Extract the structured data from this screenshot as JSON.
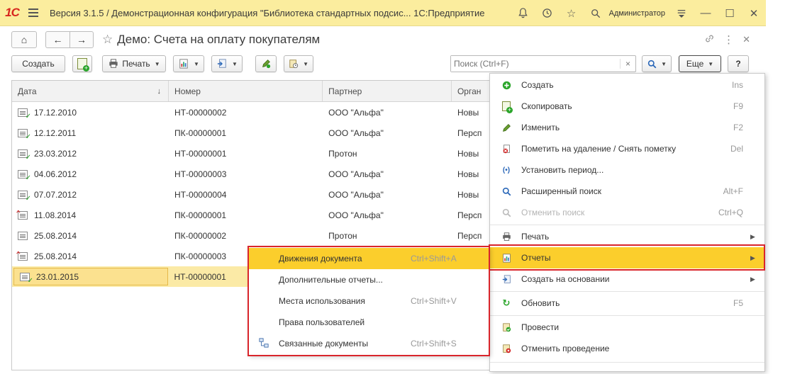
{
  "window": {
    "logo": "1С",
    "title": "Версия 3.1.5 / Демонстрационная конфигурация \"Библиотека стандартных подсис...  1С:Предприятие",
    "user": "Администратор"
  },
  "form": {
    "title": "Демо: Счета на оплату покупателям"
  },
  "toolbar": {
    "create_label": "Создать",
    "print_label": "Печать",
    "search_placeholder": "Поиск (Ctrl+F)",
    "more_label": "Еще",
    "help_label": "?"
  },
  "table": {
    "columns": [
      "Дата",
      "Номер",
      "Партнер",
      "Орган"
    ],
    "rows": [
      {
        "date": "17.12.2010",
        "number": "НТ-00000002",
        "partner": "ООО \"Альфа\"",
        "org": "Новы",
        "status": "posted"
      },
      {
        "date": "12.12.2011",
        "number": "ПК-00000001",
        "partner": "ООО \"Альфа\"",
        "org": "Персп",
        "status": "posted"
      },
      {
        "date": "23.03.2012",
        "number": "НТ-00000001",
        "partner": "Протон",
        "org": "Новы",
        "status": "posted"
      },
      {
        "date": "04.06.2012",
        "number": "НТ-00000003",
        "partner": "ООО \"Альфа\"",
        "org": "Новы",
        "status": "posted"
      },
      {
        "date": "07.07.2012",
        "number": "НТ-00000004",
        "partner": "ООО \"Альфа\"",
        "org": "Новы",
        "status": "posted"
      },
      {
        "date": "11.08.2014",
        "number": "ПК-00000001",
        "partner": "ООО \"Альфа\"",
        "org": "Персп",
        "status": "deleted"
      },
      {
        "date": "25.08.2014",
        "number": "ПК-00000002",
        "partner": "Протон",
        "org": "Персп",
        "status": "draft"
      },
      {
        "date": "25.08.2014",
        "number": "ПК-00000003",
        "partner": "",
        "org": "",
        "status": "deleted"
      },
      {
        "date": "23.01.2015",
        "number": "НТ-00000001",
        "partner": "",
        "org": "",
        "status": "posted"
      }
    ]
  },
  "menu": {
    "items": [
      {
        "label": "Создать",
        "key": "Ins",
        "icon": "plus-circle-icon"
      },
      {
        "label": "Скопировать",
        "key": "F9",
        "icon": "copy-icon"
      },
      {
        "label": "Изменить",
        "key": "F2",
        "icon": "pencil-icon"
      },
      {
        "label": "Пометить на удаление / Снять пометку",
        "key": "Del",
        "icon": "delete-mark-icon"
      },
      {
        "label": "Установить период...",
        "key": "",
        "icon": "period-icon"
      },
      {
        "label": "Расширенный поиск",
        "key": "Alt+F",
        "icon": "search-icon"
      },
      {
        "label": "Отменить поиск",
        "key": "Ctrl+Q",
        "icon": "cancel-search-icon"
      },
      {
        "label": "Печать",
        "key": "",
        "icon": "printer-icon"
      },
      {
        "label": "Отчеты",
        "key": "",
        "icon": "report-icon"
      },
      {
        "label": "Создать на основании",
        "key": "",
        "icon": "create-based-icon"
      },
      {
        "label": "Обновить",
        "key": "F5",
        "icon": "refresh-icon"
      },
      {
        "label": "Провести",
        "key": "",
        "icon": "post-icon"
      },
      {
        "label": "Отменить проведение",
        "key": "",
        "icon": "unpost-icon"
      }
    ]
  },
  "submenu": {
    "items": [
      {
        "label": "Движения документа",
        "key": "Ctrl+Shift+A"
      },
      {
        "label": "Дополнительные отчеты...",
        "key": ""
      },
      {
        "label": "Места использования",
        "key": "Ctrl+Shift+V"
      },
      {
        "label": "Права пользователей",
        "key": ""
      },
      {
        "label": "Связанные документы",
        "key": "Ctrl+Shift+S"
      }
    ]
  }
}
